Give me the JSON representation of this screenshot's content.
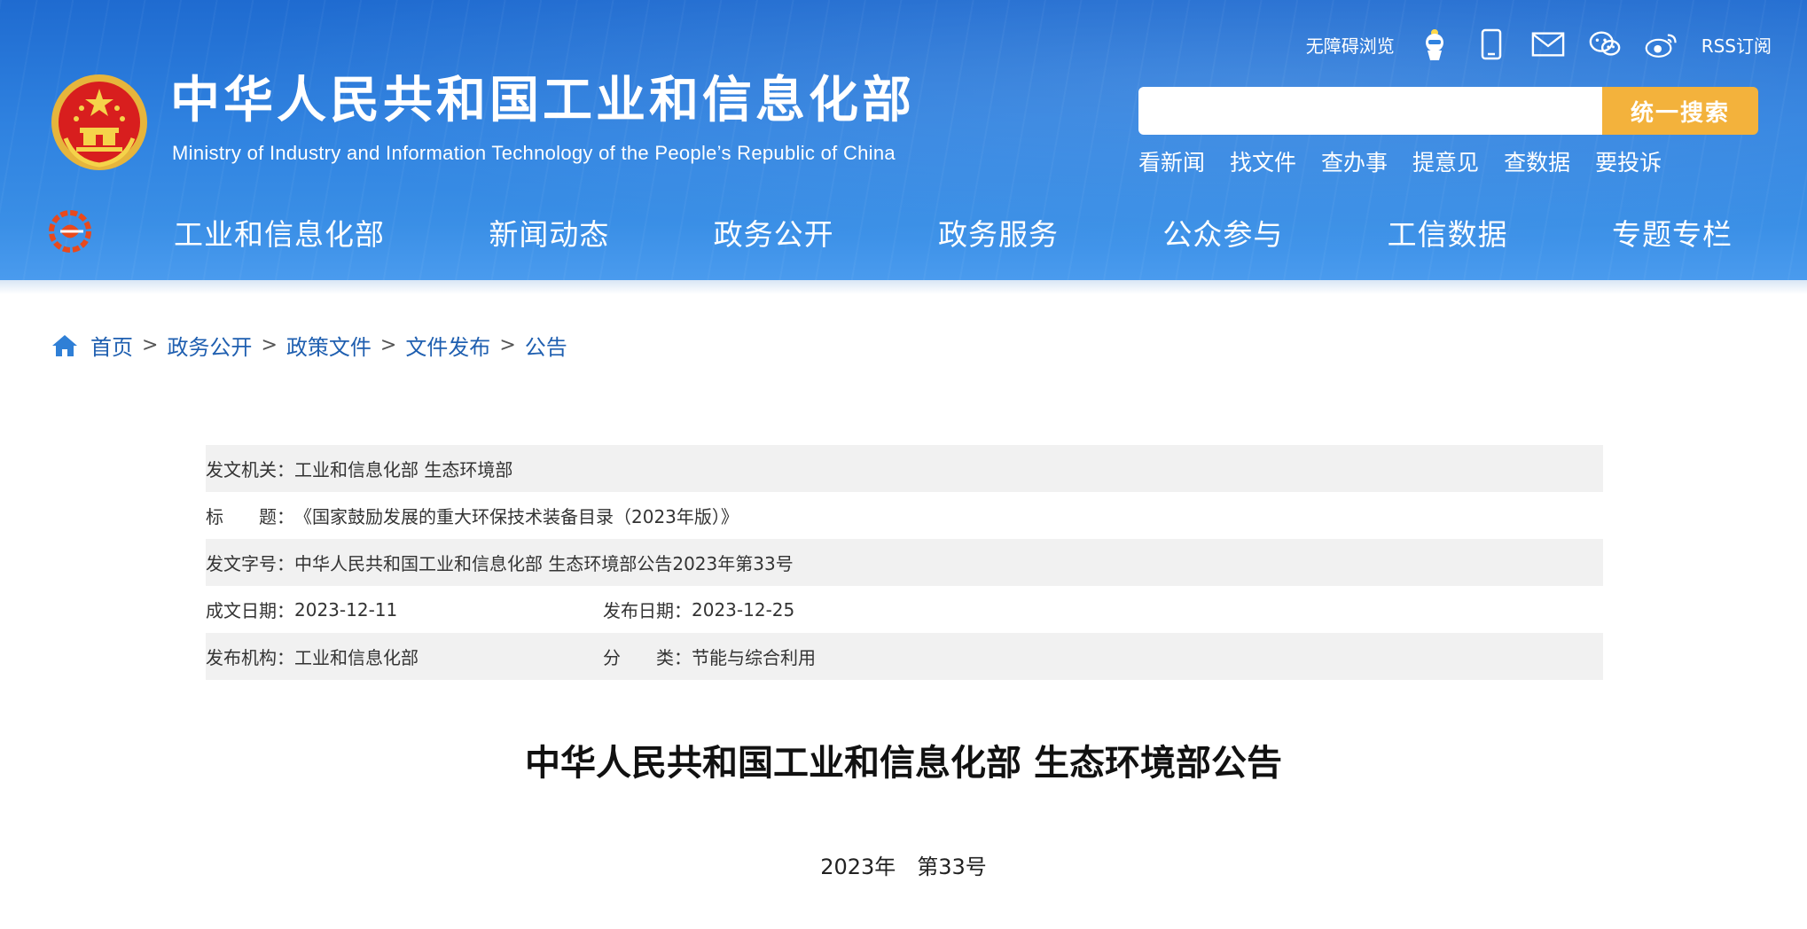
{
  "header": {
    "title": "中华人民共和国工业和信息化部",
    "subtitle": "Ministry of Industry and Information Technology of the People’s Republic of China",
    "top_links": {
      "accessibility": "无障碍浏览",
      "rss": "RSS订阅"
    },
    "search": {
      "placeholder": "",
      "button": "统一搜索"
    },
    "quick_links": [
      "看新闻",
      "找文件",
      "查办事",
      "提意见",
      "查数据",
      "要投诉"
    ],
    "colors": {
      "header_blue": "#2f82e0",
      "search_button": "#f3b23c"
    }
  },
  "nav": {
    "items": [
      "工业和信息化部",
      "新闻动态",
      "政务公开",
      "政务服务",
      "公众参与",
      "工信数据",
      "专题专栏"
    ]
  },
  "breadcrumb": {
    "items": [
      "首页",
      "政务公开",
      "政策文件",
      "文件发布",
      "公告"
    ],
    "separator": ">"
  },
  "info": {
    "issuer_label": "发文机关：",
    "issuer": "工业和信息化部 生态环境部",
    "title_label": "标　　题：",
    "title": "《国家鼓励发展的重大环保技术装备目录（2023年版）》",
    "doc_no_label": "发文字号：",
    "doc_no": "中华人民共和国工业和信息化部 生态环境部公告2023年第33号",
    "written_date_label": "成文日期：",
    "written_date": "2023-12-11",
    "publish_date_label": "发布日期：",
    "publish_date": "2023-12-25",
    "publisher_label": "发布机构：",
    "publisher": "工业和信息化部",
    "category_label": "分　　类：",
    "category": "节能与综合利用"
  },
  "document": {
    "title": "中华人民共和国工业和信息化部 生态环境部公告",
    "number": "2023年　第33号"
  }
}
